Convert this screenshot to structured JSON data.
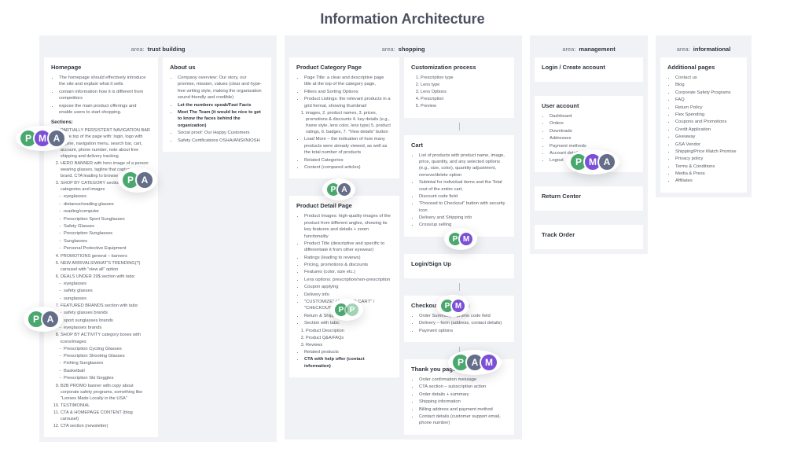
{
  "title": "Information Architecture",
  "area_label": "area:",
  "avatars": {
    "P": "P",
    "M": "M",
    "A": "A"
  },
  "areas": {
    "trust": {
      "name": "trust building",
      "homepage": {
        "title": "Homepage",
        "intro": [
          "The homepage should effectively introduce the site and explain what it sells",
          "contain information how it is different from competitors",
          "expose the main product offerings and enable users to start shopping."
        ],
        "sections_label": "Sections:",
        "sections": [
          "PARTIALLY PERSISTENT NAVIGATION BAR at the top of the page with: login, logo with tagline, navigation menu, search bar, cart, account, phone number, note about free shipping and delivery tracking",
          "HERO BANNER with hero image of a person wearing glasses, tagline that captures the brand, CTA leading to browse products",
          "SHOP BY CATEGORY section with main categories and images"
        ],
        "cat_sub": [
          "eyeglasses",
          "distance/reading glasses",
          "reading/computer",
          "Prescription Sport Sunglasses",
          "Safety Glasses",
          "Prescription Sunglasses",
          "Sunglasses",
          "Personal Protective Equipment"
        ],
        "more_sections": [
          "PROMOTIONS general – banners",
          "NEW ARRIVALS/WHAT'S TRENDING(?) carousel with \"view all\" option",
          "DEALS UNDER 29$ section with tabs:"
        ],
        "deals_sub": [
          "eyeglasses",
          "safety glasses",
          "sunglasses"
        ],
        "more2": [
          "FEATURED BRANDS section with tabs:"
        ],
        "brands_sub": [
          "safety glasses brands",
          "sport sunglasses brands",
          "eyeglasses brands"
        ],
        "more3": [
          "SHOP BY ACTIVITY category boxes with icons/images"
        ],
        "activity_sub": [
          "Prescription Cycling Glasses",
          "Prescription Shooting Glasses",
          "Fishing Sunglasses",
          "Basketball",
          "Prescription Ski Goggles"
        ],
        "more4": [
          "B2B PROMO banner with copy about corporate safety programs, something like \"Lenses Made Locally in the USA\"",
          "TESTIMONIAL"
        ],
        "more5": [
          "CTA & HOMEPAGE CONTENT (blog carousel)"
        ],
        "cta": "CTA section (newsletter)"
      },
      "about": {
        "title": "About us",
        "items": [
          "Company overview: Our story, our promise, mission, values (clear and hype-free writing style, making the organization sound friendly and credible)",
          "Let the numbers speak/Fast Facts",
          "Meet The Team (it would be nice to get to know the faces behind the organization)",
          "Social proof: Our Happy Customers",
          "Safety Certifications OSHA/ANSI/NIOSH"
        ]
      }
    },
    "shopping": {
      "name": "shopping",
      "category": {
        "title": "Product Category Page",
        "items": [
          "Page Title: a clear and descriptive page title at the top of the category page,",
          "Filters and Sorting Options",
          "Product Listings: the relevant products in a grid format, showing thumbnail"
        ],
        "numbered": [
          "images, 2. product names, 3. prices, promotions & discounts 4. key details (e.g., frame style, lens color, lens type) 5. product ratings, 6. badges, 7. \"View details\" button"
        ],
        "more": [
          "Load More – the indication of how many products were already viewed, as well as the total number of products",
          "Related Categories",
          "Content (compared articles)"
        ]
      },
      "detail": {
        "title": "Product Detail Page",
        "items": [
          "Product Images: high-quality images of the product from different angles, showing its key features and details + zoom functionality",
          "Product Title (descriptive and specific to differentiate it from other eyewear)",
          "Ratings (leading to reviews)",
          "Pricing, promotions & discounts",
          "Features (color, size etc.)",
          "Lens options: prescription/non-prescription",
          "Coupon applying",
          "Delivery info",
          "\"CUSTOMIZE\" / \"ADD TO CART\" / \"CHECKOUT\" button",
          "Return & Shipping info",
          "Section with tabs:"
        ],
        "tabs": [
          "Product Description",
          "Product Q&A/FAQs",
          "Reviews"
        ],
        "tail": [
          "Related products",
          "CTA with help offer (contact information)"
        ]
      },
      "custom": {
        "title": "Customization process",
        "items": [
          "Prescription type",
          "Lens type",
          "Lens Options",
          "Prescription",
          "Preview"
        ]
      },
      "cart": {
        "title": "Cart",
        "items": [
          "List of products with product name, image, price, quantity, and any selected options (e.g., size, color), quantity adjustment, remove/delete option",
          "Subtotal for individual items and the Total cost of the entire cart,",
          "Discount code field",
          "\"Proceed to Checkout\" button with security icon",
          "Delivery and Shipping info",
          "Cross/up selling"
        ]
      },
      "login": {
        "title": "Login/Sign Up"
      },
      "checkout": {
        "title": "Checkout  (one-page)",
        "items": [
          "Order Summary + promo code field",
          "Delivery – form (address, contact details)",
          "Payment options"
        ]
      },
      "thank": {
        "title": "Thank you page",
        "items": [
          "Order confirmation message",
          "CTA section – subscription action",
          "Order details + summary",
          "Shipping information",
          "Billing address and payment method",
          "Contact details (customer support email, phone number)"
        ]
      }
    },
    "management": {
      "name": "management",
      "login": {
        "title": "Login / Create account"
      },
      "account": {
        "title": "User account",
        "items": [
          "Dashboard",
          "Orders",
          "Downloads",
          "Addresses",
          "Payment methods",
          "Account details",
          "Logout"
        ]
      },
      "return": {
        "title": "Return Center"
      },
      "track": {
        "title": "Track Order"
      }
    },
    "info": {
      "name": "informational",
      "pages": {
        "title": "Additional pages",
        "items": [
          "Contact us",
          "Blog",
          "Corporate Safety Programs",
          "FAQ",
          "Return Policy",
          "Flex Spending",
          "Coupons and Promotions",
          "Credit Application",
          "Giveaway",
          "GSA Vendor",
          "Shipping/Price Match Promise",
          "Privacy policy",
          "Terms & Conditions",
          "Media & Press",
          "Affiliates"
        ]
      }
    }
  }
}
